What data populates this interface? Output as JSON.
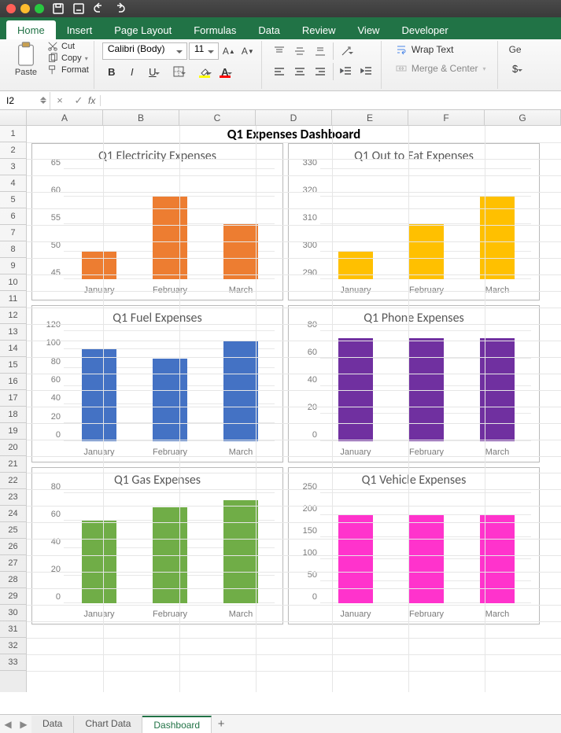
{
  "titlebar": {
    "qat": [
      "save",
      "undo",
      "redo"
    ]
  },
  "ribbon_tabs": [
    "Home",
    "Insert",
    "Page Layout",
    "Formulas",
    "Data",
    "Review",
    "View",
    "Developer"
  ],
  "ribbon": {
    "paste_label": "Paste",
    "cut_label": "Cut",
    "copy_label": "Copy",
    "format_label": "Format",
    "font_name": "Calibri (Body)",
    "font_size": "11",
    "grow_font": "A▲",
    "shrink_font": "A▼",
    "bold": "B",
    "italic": "I",
    "underline": "U",
    "fill_color": "#ffff00",
    "font_color": "#ff0000",
    "wrap_label": "Wrap Text",
    "merge_label": "Merge & Center",
    "general_label": "Ge",
    "currency": "$"
  },
  "namebox": "I2",
  "cancel_icon": "×",
  "confirm_icon": "✓",
  "fx_label": "fx",
  "columns": [
    "A",
    "B",
    "C",
    "D",
    "E",
    "F",
    "G"
  ],
  "row_count": 33,
  "dashboard_title": "Q1 Expenses Dashboard",
  "sheet_tabs": [
    "Data",
    "Chart Data",
    "Dashboard"
  ],
  "active_sheet": 2,
  "chart_data": [
    {
      "type": "bar",
      "title": "Q1 Electricity Expenses",
      "categories": [
        "January",
        "February",
        "March"
      ],
      "values": [
        50,
        60,
        55
      ],
      "ylim": [
        45,
        65
      ],
      "ystep": 5,
      "color": "#ed7d31"
    },
    {
      "type": "bar",
      "title": "Q1 Out to Eat Expenses",
      "categories": [
        "January",
        "February",
        "March"
      ],
      "values": [
        300,
        310,
        320
      ],
      "ylim": [
        290,
        330
      ],
      "ystep": 10,
      "color": "#ffc000"
    },
    {
      "type": "bar",
      "title": "Q1 Fuel Expenses",
      "categories": [
        "January",
        "February",
        "March"
      ],
      "values": [
        100,
        90,
        110
      ],
      "ylim": [
        0,
        120
      ],
      "ystep": 20,
      "color": "#4472c4"
    },
    {
      "type": "bar",
      "title": "Q1 Phone Expenses",
      "categories": [
        "January",
        "February",
        "March"
      ],
      "values": [
        75,
        75,
        75
      ],
      "ylim": [
        0,
        80
      ],
      "ystep": 20,
      "color": "#7030a0"
    },
    {
      "type": "bar",
      "title": "Q1 Gas Expenses",
      "categories": [
        "January",
        "February",
        "March"
      ],
      "values": [
        60,
        70,
        75
      ],
      "ylim": [
        0,
        80
      ],
      "ystep": 20,
      "color": "#70ad47"
    },
    {
      "type": "bar",
      "title": "Q1 Vehicle Expenses",
      "categories": [
        "January",
        "February",
        "March"
      ],
      "values": [
        200,
        200,
        200
      ],
      "ylim": [
        0,
        250
      ],
      "ystep": 50,
      "color": "#ff33cc"
    }
  ]
}
